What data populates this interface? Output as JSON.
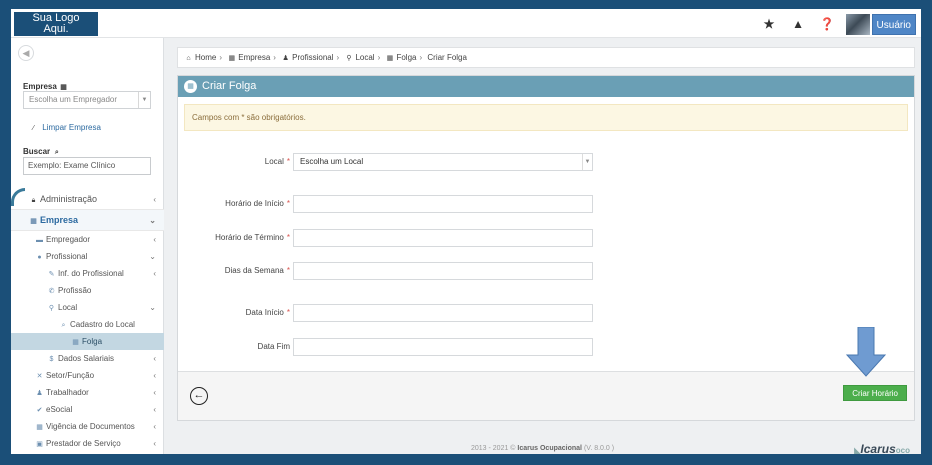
{
  "topbar": {
    "logo_line1": "Sua Logo",
    "logo_line2": "Aqui.",
    "icons": [
      "star-icon",
      "warning-icon",
      "help-icon"
    ],
    "user_label": "Usuário"
  },
  "sidebar": {
    "empresa_label": "Empresa",
    "empresa_select": "Escolha um Empregador",
    "clear_label": "Limpar Empresa",
    "search_label": "Buscar",
    "search_placeholder": "Exemplo: Exame Clínico",
    "menu": [
      {
        "label": "Administração",
        "level": 0
      },
      {
        "label": "Empresa",
        "level": 0,
        "active": true
      },
      {
        "label": "Empregador",
        "level": 1
      },
      {
        "label": "Profissional",
        "level": 1
      },
      {
        "label": "Inf. do Profissional",
        "level": 2
      },
      {
        "label": "Profissão",
        "level": 2
      },
      {
        "label": "Local",
        "level": 2
      },
      {
        "label": "Cadastro do Local",
        "level": 3
      },
      {
        "label": "Folga",
        "level": 4,
        "selected": true
      },
      {
        "label": "Dados Salariais",
        "level": 2
      },
      {
        "label": "Setor/Função",
        "level": 1
      },
      {
        "label": "Trabalhador",
        "level": 1
      },
      {
        "label": "eSocial",
        "level": 1
      },
      {
        "label": "Vigência de Documentos",
        "level": 1
      },
      {
        "label": "Prestador de Serviço",
        "level": 1
      }
    ]
  },
  "breadcrumb": {
    "items": [
      "Home",
      "Empresa",
      "Profissional",
      "Local",
      "Folga",
      "Criar Folga"
    ]
  },
  "panel": {
    "title": "Criar Folga",
    "alert": "Campos com * são obrigatórios.",
    "fields": [
      {
        "label": "Local",
        "required": true,
        "value": "Escolha um Local",
        "type": "select"
      },
      {
        "label": "Horário de Início",
        "required": true,
        "value": ""
      },
      {
        "label": "Horário de Término",
        "required": true,
        "value": ""
      },
      {
        "label": "Dias da Semana",
        "required": true,
        "value": ""
      },
      {
        "label": "Data Início",
        "required": true,
        "value": ""
      },
      {
        "label": "Data Fim",
        "required": false,
        "value": ""
      }
    ],
    "create_button": "Criar Horário"
  },
  "footer": {
    "copyright": "2013 - 2021 ©",
    "brand": "Icarus Ocupacional",
    "version": "(V. 8.0.0 )",
    "logo_text": "Icarus",
    "logo_suffix": "ᴏᴄᴏ"
  },
  "colors": {
    "background": "#1b4f78",
    "panel_header": "#6a9fb5",
    "create_button": "#4cae4c",
    "user_button": "#4f86c6",
    "selected_menu": "#c3d7e2"
  }
}
